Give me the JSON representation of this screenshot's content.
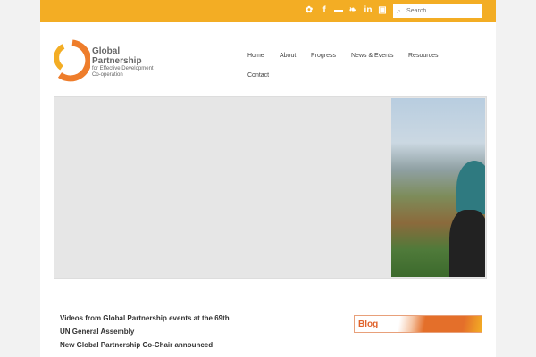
{
  "social": [
    {
      "name": "delicious-icon",
      "glyph": "✿"
    },
    {
      "name": "facebook-icon",
      "glyph": "f"
    },
    {
      "name": "chat-icon",
      "glyph": "▬"
    },
    {
      "name": "twitter-icon",
      "glyph": "❧"
    },
    {
      "name": "linkedin-icon",
      "glyph": "in"
    },
    {
      "name": "youtube-icon",
      "glyph": "▣"
    }
  ],
  "search": {
    "placeholder": "Search"
  },
  "logo": {
    "line1": "Global",
    "line2": "Partnership",
    "line3": "for Effective Development",
    "line4": "Co-operation"
  },
  "nav": [
    "Home",
    "About",
    "Progress",
    "News & Events",
    "Resources",
    "Contact"
  ],
  "news": [
    "Videos from Global Partnership events at the 69th",
    "UN General Assembly",
    "New Global Partnership Co-Chair announced"
  ],
  "blog": {
    "label": "Blog"
  },
  "colors": {
    "accent": "#f3ad24",
    "orange": "#e46f2a"
  }
}
